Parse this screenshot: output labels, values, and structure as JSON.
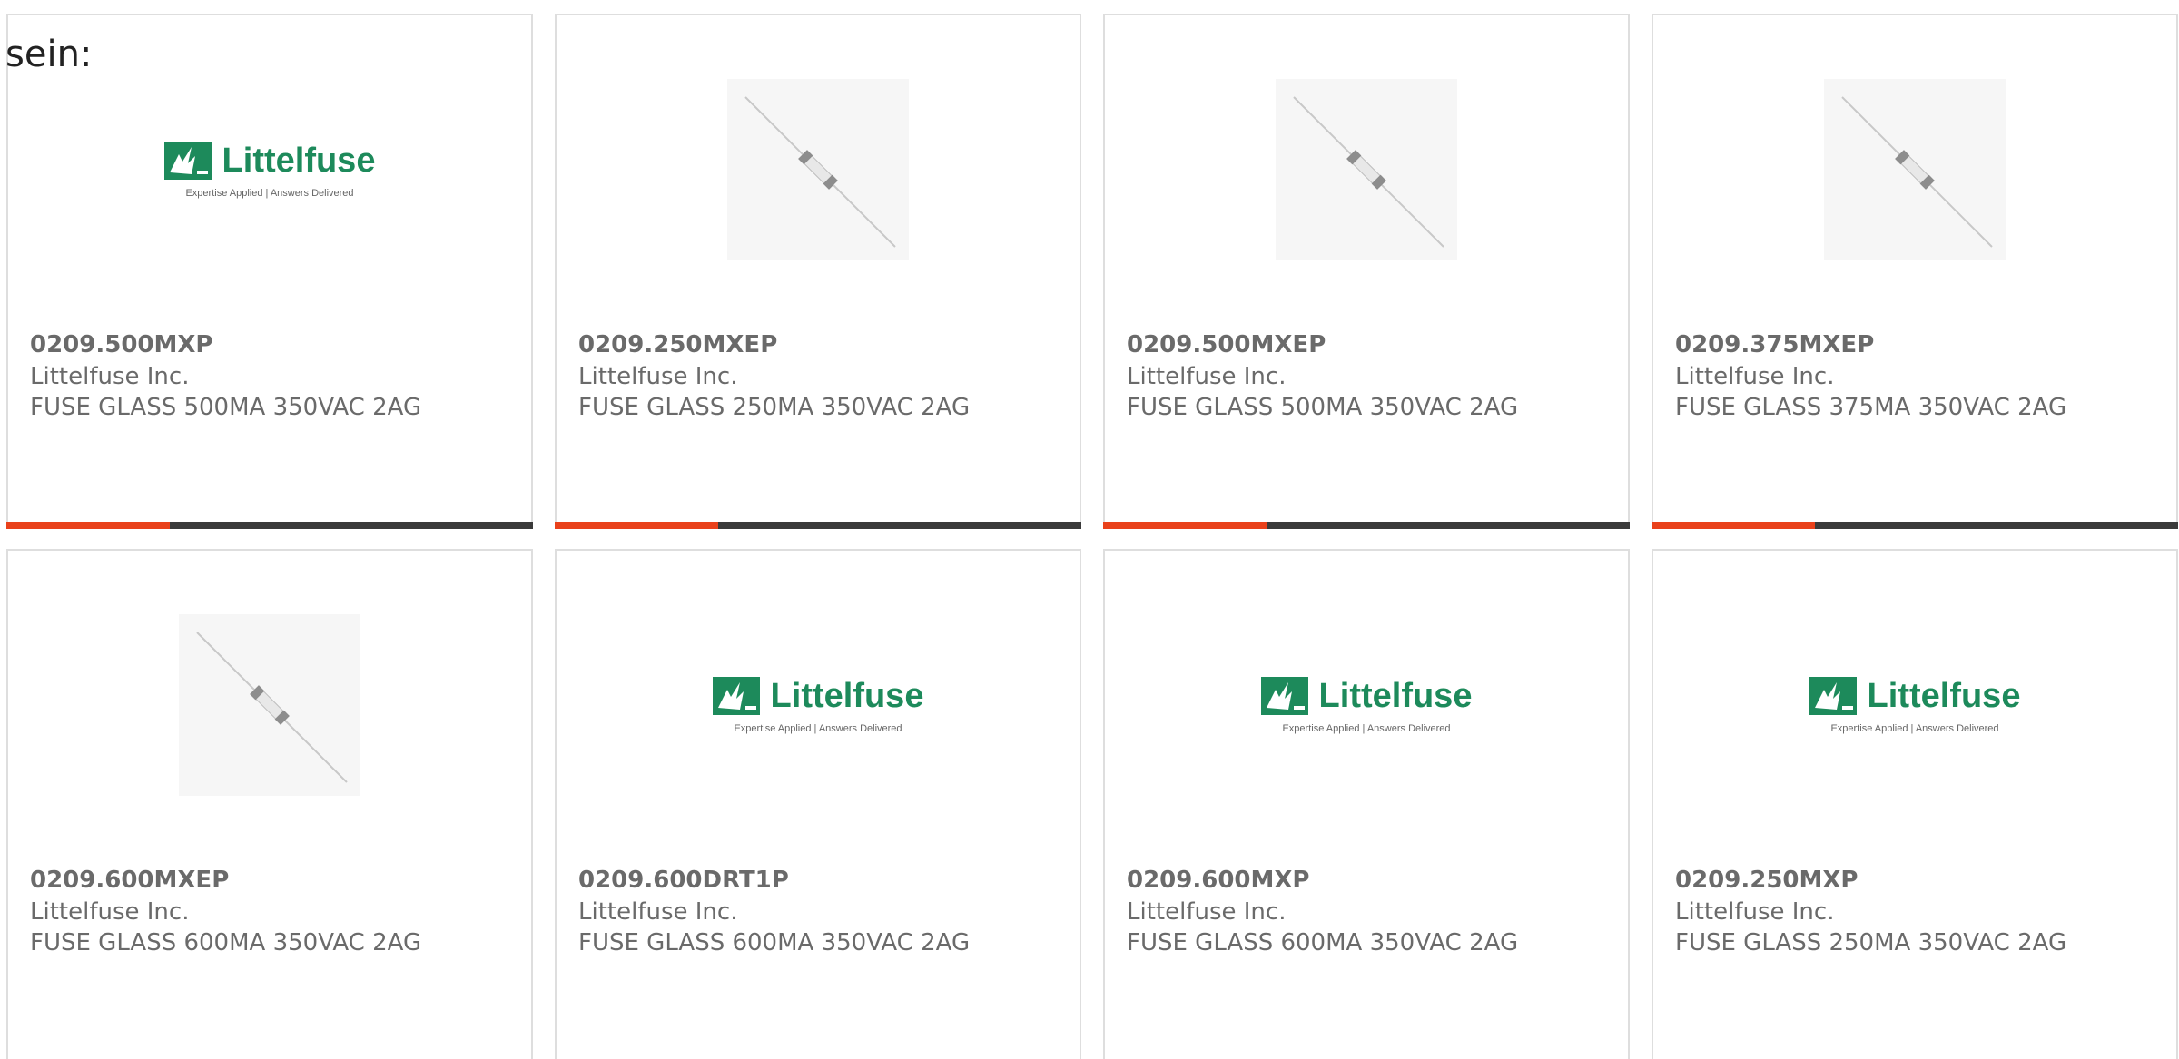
{
  "lead_text": "sein:",
  "brand_color": "#1d8a5b",
  "accent_color": "#e9411b",
  "bar_track_color": "#3a3a3a",
  "logo": {
    "word": "Littelfuse",
    "tagline": "Expertise Applied | Answers Delivered"
  },
  "products": [
    {
      "part": "0209.500MXP",
      "manufacturer": "Littelfuse Inc.",
      "description": "FUSE GLASS 500MA 350VAC 2AG",
      "image": "littelfuse-logo"
    },
    {
      "part": "0209.250MXEP",
      "manufacturer": "Littelfuse Inc.",
      "description": "FUSE GLASS 250MA 350VAC 2AG",
      "image": "fuse-photo"
    },
    {
      "part": "0209.500MXEP",
      "manufacturer": "Littelfuse Inc.",
      "description": "FUSE GLASS 500MA 350VAC 2AG",
      "image": "fuse-photo"
    },
    {
      "part": "0209.375MXEP",
      "manufacturer": "Littelfuse Inc.",
      "description": "FUSE GLASS 375MA 350VAC 2AG",
      "image": "fuse-photo"
    },
    {
      "part": "0209.600MXEP",
      "manufacturer": "Littelfuse Inc.",
      "description": "FUSE GLASS 600MA 350VAC 2AG",
      "image": "fuse-photo"
    },
    {
      "part": "0209.600DRT1P",
      "manufacturer": "Littelfuse Inc.",
      "description": "FUSE GLASS 600MA 350VAC 2AG",
      "image": "littelfuse-logo"
    },
    {
      "part": "0209.600MXP",
      "manufacturer": "Littelfuse Inc.",
      "description": "FUSE GLASS 600MA 350VAC 2AG",
      "image": "littelfuse-logo"
    },
    {
      "part": "0209.250MXP",
      "manufacturer": "Littelfuse Inc.",
      "description": "FUSE GLASS 250MA 350VAC 2AG",
      "image": "littelfuse-logo"
    }
  ],
  "row1_progress_fraction": 0.31
}
